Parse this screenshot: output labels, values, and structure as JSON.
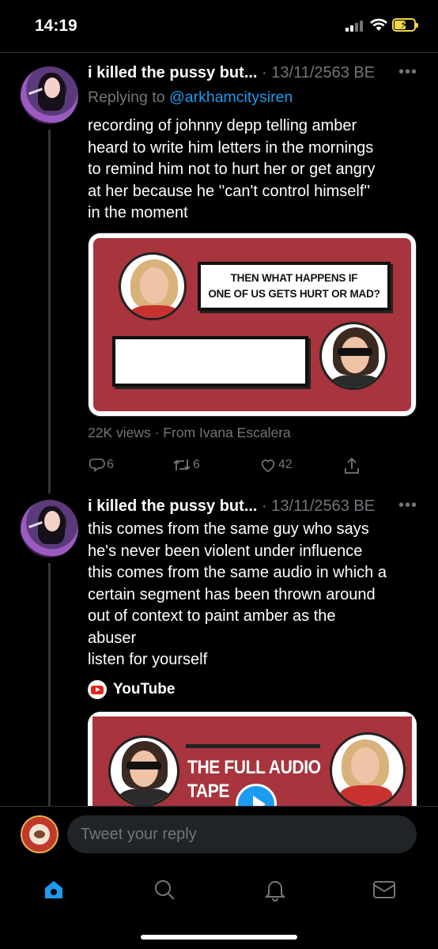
{
  "status_bar": {
    "time": "14:19"
  },
  "colors": {
    "accent": "#1d9bf0",
    "muted": "#71767b",
    "background": "#000000",
    "card_red": "#a8343d",
    "battery": "#f5d64a"
  },
  "tweets": [
    {
      "author": "i killed the pussy but...",
      "date": "· 13/11/2563 BE",
      "reply_prefix": "Replying to ",
      "reply_handle": "@arkhamcitysiren",
      "text_lines": [
        "recording of johnny depp telling amber",
        "heard to write him letters in the mornings",
        "to remind him not to hurt her or get angry",
        "at her because he ''can't control himself''",
        "in the moment"
      ],
      "media": {
        "caption": "THEN WHAT HAPPENS IF\nONE OF US GETS HURT OR MAD?",
        "meta": "22K views · From Ivana Escalera"
      },
      "actions": {
        "replies": "6",
        "retweets": "6",
        "likes": "42"
      }
    },
    {
      "author": "i killed the pussy but...",
      "date": "· 13/11/2563 BE",
      "text_lines": [
        "this comes from the same guy who says",
        "he's never been violent under influence",
        "this comes from the same audio in which a",
        "certain segment has been thrown around",
        "out of context to paint amber as the",
        "abuser",
        "listen for yourself"
      ],
      "card": {
        "source": "YouTube",
        "headline": "THE FULL AUDIO\nTAPE"
      }
    }
  ],
  "more_icon": "•••",
  "reply_bar": {
    "placeholder": "Tweet your reply"
  },
  "tabs": [
    {
      "icon": "home-icon",
      "active": true
    },
    {
      "icon": "search-icon",
      "active": false
    },
    {
      "icon": "bell-icon",
      "active": false
    },
    {
      "icon": "mail-icon",
      "active": false
    }
  ]
}
